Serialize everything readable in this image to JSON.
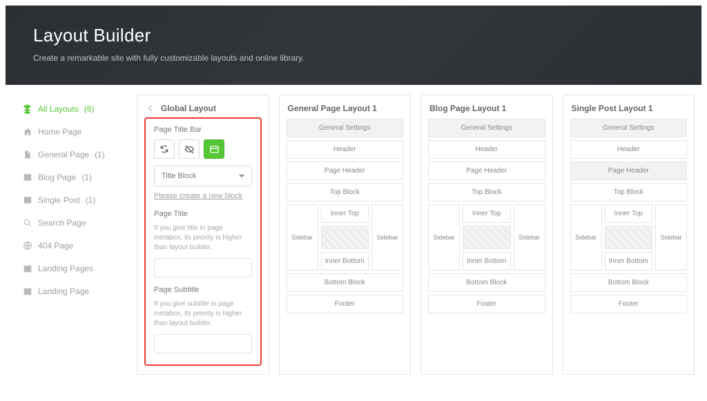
{
  "hero": {
    "title": "Layout Builder",
    "subtitle": "Create a remarkable site with fully customizable layouts and online library."
  },
  "sidebar": {
    "items": [
      {
        "label": "All Layouts",
        "count": "(6)",
        "icon": "layers",
        "active": true
      },
      {
        "label": "Home Page",
        "count": "",
        "icon": "home"
      },
      {
        "label": "General Page",
        "count": "(1)",
        "icon": "file"
      },
      {
        "label": "Blog Page",
        "count": "(1)",
        "icon": "news"
      },
      {
        "label": "Single Post",
        "count": "(1)",
        "icon": "news"
      },
      {
        "label": "Search Page",
        "count": "",
        "icon": "search"
      },
      {
        "label": "404 Page",
        "count": "",
        "icon": "globe"
      },
      {
        "label": "Landing Pages",
        "count": "",
        "icon": "cal"
      },
      {
        "label": "Landing Page",
        "count": "",
        "icon": "cal"
      }
    ]
  },
  "global": {
    "title": "Global Layout",
    "sec_title_bar": "Page Title Bar",
    "select_value": "Title Block",
    "create_link": "Please create a new block",
    "page_title_label": "Page Title",
    "page_title_hint": "If you give title in page metabox, its priority is higher than layout builder.",
    "page_title_value": "",
    "page_subtitle_label": "Page Subtitle",
    "page_subtitle_hint": "If you give subtitle in page metabox, its priority is higher than layout builder.",
    "page_subtitle_value": ""
  },
  "rows": {
    "general_settings": "General Settings",
    "header": "Header",
    "page_header": "Page Header",
    "top_block": "Top Block",
    "inner_top": "Inner Top",
    "sidebar": "Sidebar",
    "inner_bottom": "Inner Bottom",
    "bottom_block": "Bottom Block",
    "footer": "Footer"
  },
  "cards": [
    {
      "title": "General Page Layout 1"
    },
    {
      "title": "Blog Page Layout 1"
    },
    {
      "title": "Single Post Layout 1"
    }
  ]
}
